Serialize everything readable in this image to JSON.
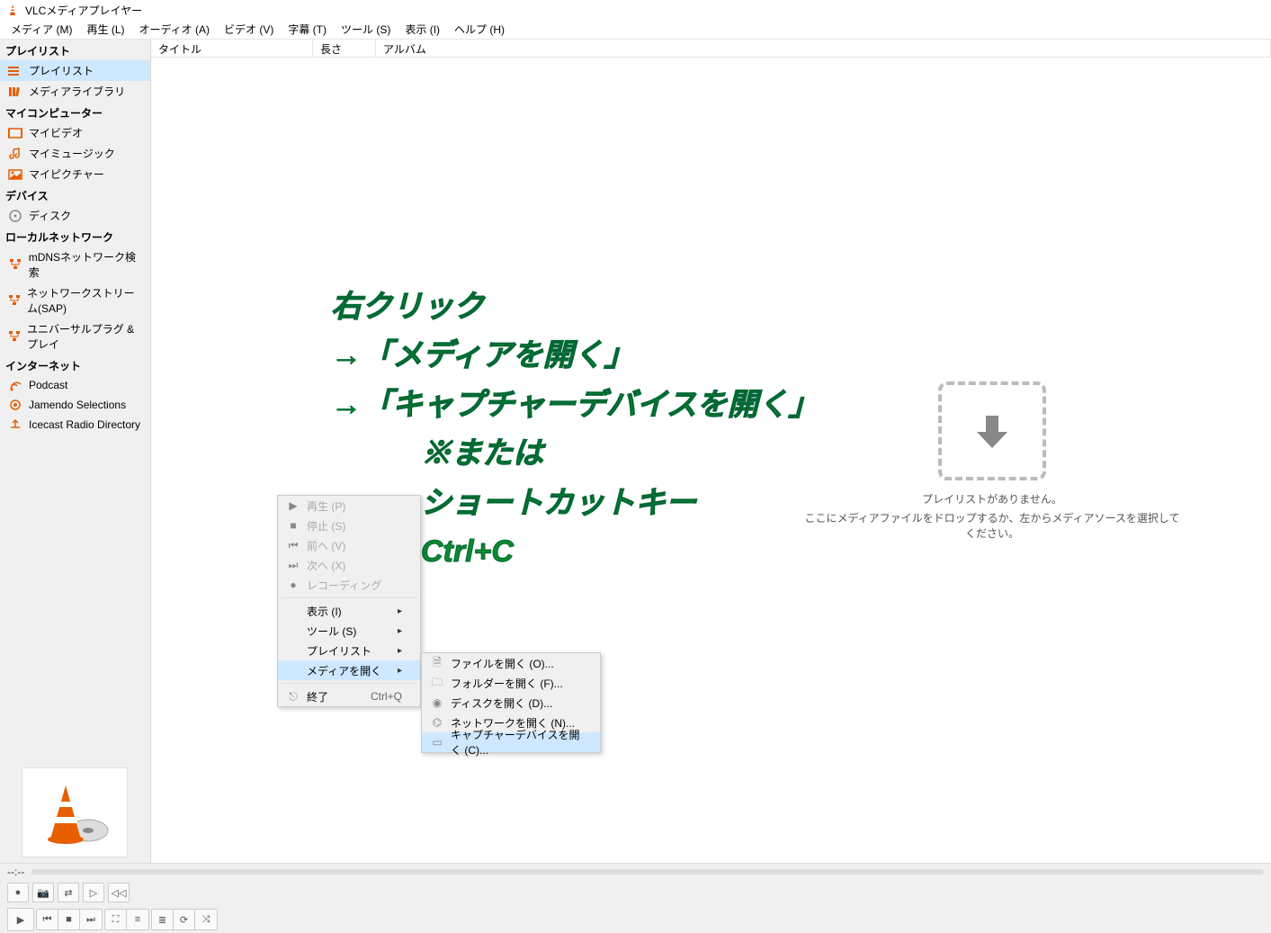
{
  "titlebar": {
    "title": "VLCメディアプレイヤー"
  },
  "menubar": [
    "メディア (M)",
    "再生 (L)",
    "オーディオ (A)",
    "ビデオ (V)",
    "字幕 (T)",
    "ツール (S)",
    "表示 (I)",
    "ヘルプ (H)"
  ],
  "sidebar": {
    "sections": [
      {
        "header": "プレイリスト",
        "items": [
          {
            "label": "プレイリスト",
            "icon": "playlist-icon",
            "selected": true
          },
          {
            "label": "メディアライブラリ",
            "icon": "library-icon"
          }
        ]
      },
      {
        "header": "マイコンピューター",
        "items": [
          {
            "label": "マイビデオ",
            "icon": "video-icon"
          },
          {
            "label": "マイミュージック",
            "icon": "music-icon"
          },
          {
            "label": "マイピクチャー",
            "icon": "picture-icon"
          }
        ]
      },
      {
        "header": "デバイス",
        "items": [
          {
            "label": "ディスク",
            "icon": "disc-icon"
          }
        ]
      },
      {
        "header": "ローカルネットワーク",
        "items": [
          {
            "label": "mDNSネットワーク検索",
            "icon": "network-icon"
          },
          {
            "label": "ネットワークストリーム(SAP)",
            "icon": "network-icon"
          },
          {
            "label": "ユニバーサルプラグ & プレイ",
            "icon": "network-icon"
          }
        ]
      },
      {
        "header": "インターネット",
        "items": [
          {
            "label": "Podcast",
            "icon": "podcast-icon"
          },
          {
            "label": "Jamendo Selections",
            "icon": "jamendo-icon"
          },
          {
            "label": "Icecast Radio Directory",
            "icon": "icecast-icon"
          }
        ]
      }
    ]
  },
  "columns": {
    "title": "タイトル",
    "length": "長さ",
    "album": "アルバム"
  },
  "dropzone": {
    "line1": "プレイリストがありません。",
    "line2": "ここにメディアファイルをドロップするか、左からメディアソースを選択してください。"
  },
  "context_menu1": [
    {
      "type": "item",
      "label": "再生 (P)",
      "icon": "play-icon",
      "disabled": true
    },
    {
      "type": "item",
      "label": "停止 (S)",
      "icon": "stop-icon",
      "disabled": true
    },
    {
      "type": "item",
      "label": "前へ (V)",
      "icon": "prev-icon",
      "disabled": true
    },
    {
      "type": "item",
      "label": "次へ (X)",
      "icon": "next-icon",
      "disabled": true
    },
    {
      "type": "item",
      "label": "レコーディング",
      "icon": "record-icon",
      "disabled": true
    },
    {
      "type": "sep"
    },
    {
      "type": "item",
      "label": "表示 (I)",
      "submenu": true
    },
    {
      "type": "item",
      "label": "ツール (S)",
      "submenu": true
    },
    {
      "type": "item",
      "label": "プレイリスト",
      "submenu": true
    },
    {
      "type": "item",
      "label": "メディアを開く",
      "submenu": true,
      "highlighted": true
    },
    {
      "type": "sep"
    },
    {
      "type": "item",
      "label": "終了",
      "icon": "exit-icon",
      "shortcut": "Ctrl+Q"
    }
  ],
  "context_menu2": [
    {
      "type": "item",
      "label": "ファイルを開く (O)...",
      "icon": "file-icon"
    },
    {
      "type": "item",
      "label": "フォルダーを開く (F)...",
      "icon": "folder-icon"
    },
    {
      "type": "item",
      "label": "ディスクを開く (D)...",
      "icon": "disc-small-icon"
    },
    {
      "type": "item",
      "label": "ネットワークを開く (N)...",
      "icon": "network-small-icon"
    },
    {
      "type": "item",
      "label": "キャプチャーデバイスを開く (C)...",
      "icon": "capture-icon",
      "highlighted": true
    }
  ],
  "annotation": {
    "line1": "右クリック",
    "line2": "→「メディアを開く」",
    "line3": "→「キャプチャーデバイスを開く」",
    "line4": "※または",
    "line5": "ショートカットキー",
    "line6": "Ctrl+C"
  },
  "timeline": {
    "time": "--:--"
  }
}
